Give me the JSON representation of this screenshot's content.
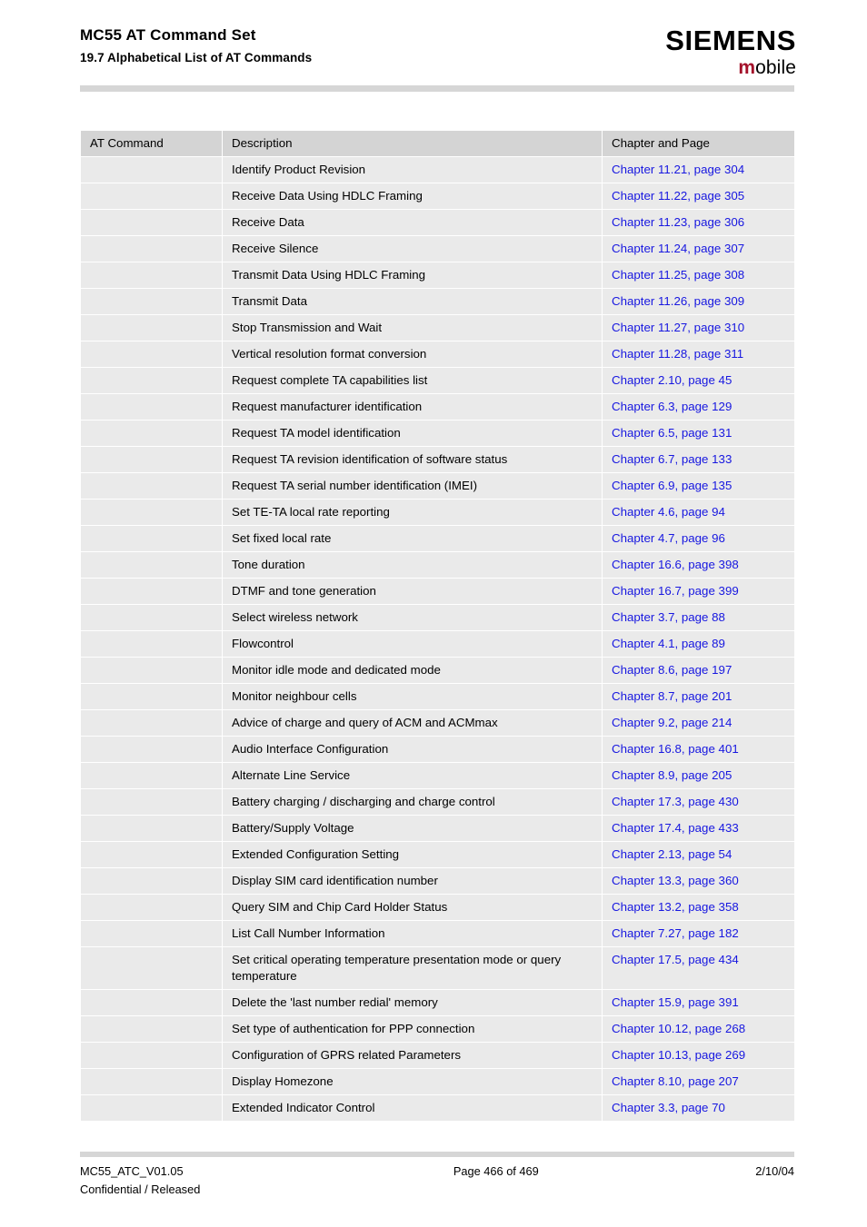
{
  "header": {
    "doc_title": "MC55 AT Command Set",
    "section_title": "19.7 Alphabetical List of AT Commands",
    "brand_main": "SIEMENS",
    "brand_sub_accent": "m",
    "brand_sub_rest": "obile",
    "accent_color": "#a4112a"
  },
  "table": {
    "columns": [
      "AT Command",
      "Description",
      "Chapter and Page"
    ],
    "link_color": "#1717e0",
    "header_bg": "#d4d4d4",
    "row_bg": "#eaeaea",
    "rows": [
      {
        "command": "",
        "description": "Identify Product Revision",
        "chapter": "Chapter 11.21, page 304"
      },
      {
        "command": "",
        "description": "Receive Data Using HDLC Framing",
        "chapter": "Chapter 11.22, page 305"
      },
      {
        "command": "",
        "description": "Receive Data",
        "chapter": "Chapter 11.23, page 306"
      },
      {
        "command": "",
        "description": "Receive Silence",
        "chapter": "Chapter 11.24, page 307"
      },
      {
        "command": "",
        "description": "Transmit Data Using HDLC Framing",
        "chapter": "Chapter 11.25, page 308"
      },
      {
        "command": "",
        "description": "Transmit Data",
        "chapter": "Chapter 11.26, page 309"
      },
      {
        "command": "",
        "description": "Stop Transmission and Wait",
        "chapter": "Chapter 11.27, page 310"
      },
      {
        "command": "",
        "description": "Vertical resolution format conversion",
        "chapter": "Chapter 11.28, page 311"
      },
      {
        "command": "",
        "description": "Request complete TA capabilities list",
        "chapter": "Chapter 2.10, page 45"
      },
      {
        "command": "",
        "description": "Request manufacturer identification",
        "chapter": "Chapter 6.3, page 129"
      },
      {
        "command": "",
        "description": "Request TA model identification",
        "chapter": "Chapter 6.5, page 131"
      },
      {
        "command": "",
        "description": "Request TA revision identification of software status",
        "chapter": "Chapter 6.7, page 133"
      },
      {
        "command": "",
        "description": "Request TA serial number identification (IMEI)",
        "chapter": "Chapter 6.9, page 135"
      },
      {
        "command": "",
        "description": "Set TE-TA local rate reporting",
        "chapter": "Chapter 4.6, page 94"
      },
      {
        "command": "",
        "description": "Set fixed local rate",
        "chapter": "Chapter 4.7, page 96"
      },
      {
        "command": "",
        "description": "Tone duration",
        "chapter": "Chapter 16.6, page 398"
      },
      {
        "command": "",
        "description": "DTMF and tone generation",
        "chapter": "Chapter 16.7, page 399"
      },
      {
        "command": "",
        "description": "Select wireless network",
        "chapter": "Chapter 3.7, page 88"
      },
      {
        "command": "",
        "description": "Flowcontrol",
        "chapter": "Chapter 4.1, page 89"
      },
      {
        "command": "",
        "description": "Monitor idle mode and dedicated mode",
        "chapter": "Chapter 8.6, page 197"
      },
      {
        "command": "",
        "description": "Monitor neighbour cells",
        "chapter": "Chapter 8.7, page 201"
      },
      {
        "command": "",
        "description": "Advice of charge and query of ACM and ACMmax",
        "chapter": "Chapter 9.2, page 214"
      },
      {
        "command": "",
        "description": "Audio Interface Configuration",
        "chapter": "Chapter 16.8, page 401"
      },
      {
        "command": "",
        "description": "Alternate Line Service",
        "chapter": "Chapter 8.9, page 205"
      },
      {
        "command": "",
        "description": "Battery charging / discharging and charge control",
        "chapter": "Chapter 17.3, page 430"
      },
      {
        "command": "",
        "description": "Battery/Supply Voltage",
        "chapter": "Chapter 17.4, page 433"
      },
      {
        "command": "",
        "description": "Extended Configuration Setting",
        "chapter": "Chapter 2.13, page 54"
      },
      {
        "command": "",
        "description": "Display SIM card identification number",
        "chapter": "Chapter 13.3, page 360"
      },
      {
        "command": "",
        "description": "Query SIM and Chip Card Holder Status",
        "chapter": "Chapter 13.2, page 358"
      },
      {
        "command": "",
        "description": "List Call Number Information",
        "chapter": "Chapter 7.27, page 182"
      },
      {
        "command": "",
        "description": "Set critical operating temperature presentation mode or query temperature",
        "chapter": "Chapter 17.5, page 434"
      },
      {
        "command": "",
        "description": "Delete the 'last number redial' memory",
        "chapter": "Chapter 15.9, page 391"
      },
      {
        "command": "",
        "description": "Set type of authentication for PPP connection",
        "chapter": "Chapter 10.12, page 268"
      },
      {
        "command": "",
        "description": "Configuration of GPRS related Parameters",
        "chapter": "Chapter 10.13, page 269"
      },
      {
        "command": "",
        "description": "Display Homezone",
        "chapter": "Chapter 8.10, page 207"
      },
      {
        "command": "",
        "description": "Extended Indicator Control",
        "chapter": "Chapter 3.3, page 70"
      }
    ]
  },
  "footer": {
    "doc_id": "MC55_ATC_V01.05",
    "classification": "Confidential / Released",
    "page_info": "Page 466 of 469",
    "date": "2/10/04"
  }
}
